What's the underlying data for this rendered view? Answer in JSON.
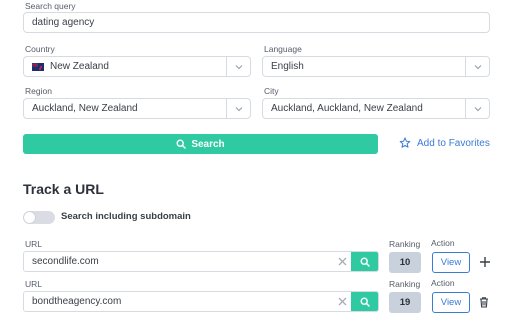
{
  "search": {
    "query_label": "Search query",
    "query_value": "dating agency",
    "country_label": "Country",
    "country_value": "New Zealand",
    "language_label": "Language",
    "language_value": "English",
    "region_label": "Region",
    "region_value": "Auckland, New Zealand",
    "city_label": "City",
    "city_value": "Auckland, Auckland, New Zealand",
    "search_button": "Search",
    "favorites_link": "Add to Favorites"
  },
  "track": {
    "title": "Track a URL",
    "subdomain_toggle_label": "Search including subdomain",
    "subdomain_enabled": false,
    "rows": [
      {
        "url_label": "URL",
        "url": "secondlife.com",
        "ranking_label": "Ranking",
        "ranking": "10",
        "action_label": "Action",
        "view_label": "View",
        "extra_icon": "plus-icon"
      },
      {
        "url_label": "URL",
        "url": "bondtheagency.com",
        "ranking_label": "Ranking",
        "ranking": "19",
        "action_label": "Action",
        "view_label": "View",
        "extra_icon": "trash-icon"
      }
    ]
  },
  "colors": {
    "accent": "#2fc9a2",
    "link": "#3a7bd5",
    "rank_bg": "#c8d1dc"
  }
}
